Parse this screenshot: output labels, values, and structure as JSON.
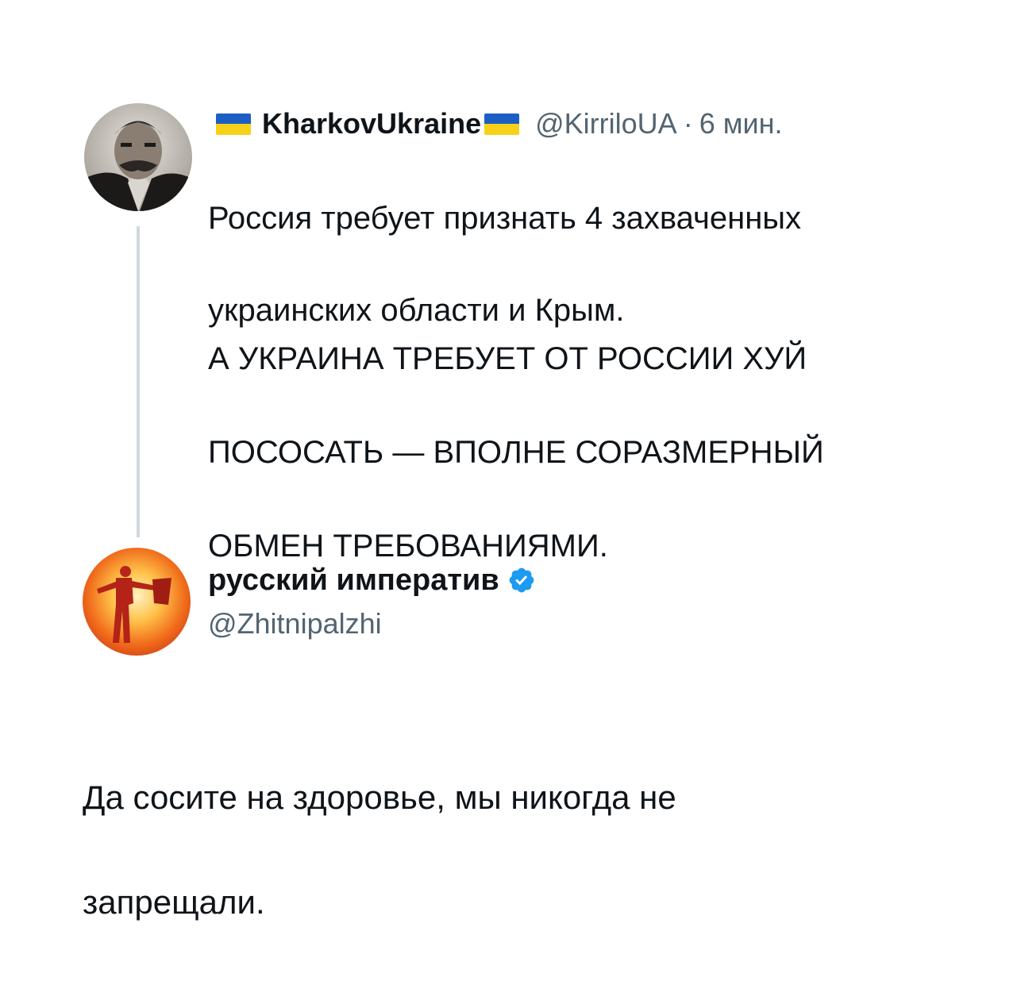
{
  "tweet1": {
    "display_name": "KharkovUkraine",
    "handle": "@KirriloUA",
    "separator": "·",
    "time": "6 мин.",
    "avatar_icon": "portrait-avatar-icon",
    "flag_icon": "ukraine-flag-icon",
    "text_line1": "Россия требует признать 4 захваченных",
    "text_line2": "украинских области и Крым.",
    "text_line3": "А УКРАИНА ТРЕБУЕТ ОТ РОССИИ ХУЙ",
    "text_line4": "ПОСОСАТЬ — ВПОЛНЕ СОРАЗМЕРНЫЙ",
    "text_line5": "ОБМЕН ТРЕБОВАНИЯМИ."
  },
  "tweet2": {
    "display_name": "русский императив",
    "handle": "@Zhitnipalzhi",
    "verified_icon": "verified-badge-icon",
    "avatar_icon": "fire-figure-avatar-icon",
    "text_line1": "Да сосите на здоровье, мы никогда не",
    "text_line2": "запрещали."
  },
  "colors": {
    "text": "#0f1419",
    "secondary": "#536471",
    "thread_line": "#cfd9de",
    "verified": "#1d9bf0",
    "flag_blue": "#1d5ec4",
    "flag_yellow": "#f7d117"
  }
}
